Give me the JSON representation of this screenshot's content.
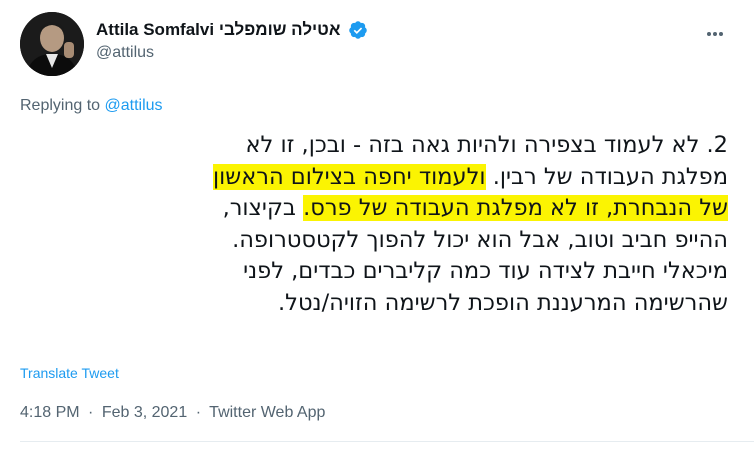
{
  "author": {
    "display_name": "Attila Somfalvi אטילה שומפלבי",
    "handle": "@attilus"
  },
  "reply": {
    "prefix": "Replying to",
    "mention": "@attilus"
  },
  "tweet": {
    "line1": "2. לא לעמוד בצפירה ולהיות גאה בזה - ובכן, זו לא",
    "line2_plain": "מפלגת העבודה של רבין.",
    "line2_highlight": "ולעמוד יחפה בצילום הראשון",
    "line3_highlight": "של הנבחרת, זו לא מפלגת העבודה של פרס.",
    "line3_plain": "בקיצור,",
    "line4": "ההייפ חביב וטוב, אבל הוא יכול להפוך לקטסטרופה.",
    "line5": "מיכאלי חייבת לצידה עוד כמה קליברים כבדים, לפני",
    "line6": "שהרשימה המרעננת הופכת לרשימה הזויה/נטל."
  },
  "translate_label": "Translate Tweet",
  "meta": {
    "time": "4:18 PM",
    "sep1": "·",
    "date": "Feb 3, 2021",
    "sep2": "·",
    "source": "Twitter Web App"
  },
  "colors": {
    "highlight": "#fbf402",
    "link": "#1d9bf0",
    "muted": "#536471"
  },
  "icons": [
    "avatar",
    "verified-badge-icon",
    "more-options-icon"
  ]
}
